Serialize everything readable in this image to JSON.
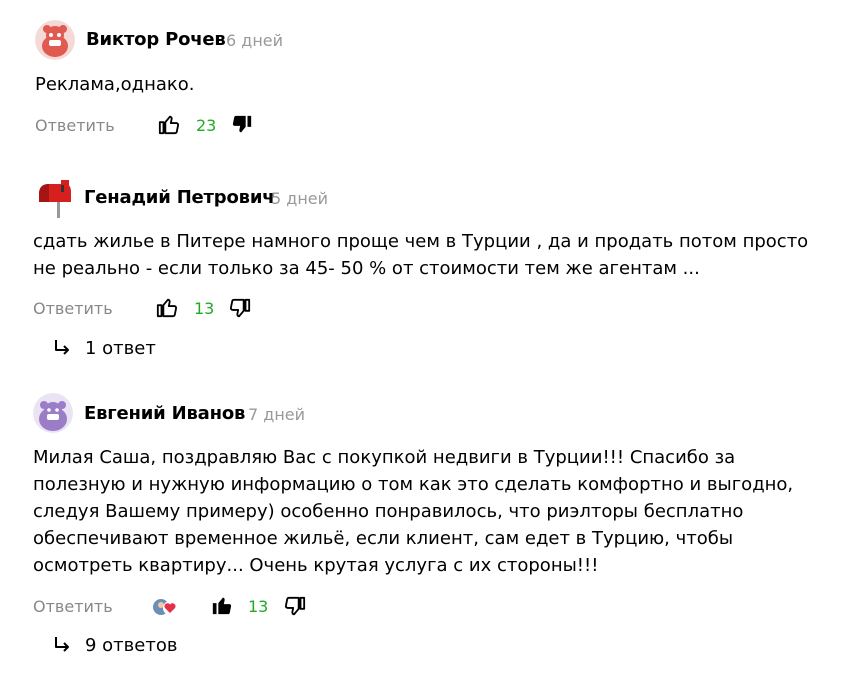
{
  "comments": [
    {
      "author": "Виктор Рочев",
      "date": "6 дней",
      "text": "Реклама,однако.",
      "reply_label": "Ответить",
      "likes": "23",
      "avatar_icon": "red-face-avatar"
    },
    {
      "author": "Генадий Петрович",
      "date": "5 дней",
      "text": "сдать жилье в Питере намного проще чем в Турции , да и продать потом просто\nне реально - если только за 45- 50 % от стоимости тем же агентам ...",
      "reply_label": "Ответить",
      "likes": "13",
      "answers": "1 ответ",
      "avatar_icon": "mailbox-avatar"
    },
    {
      "author": "Евгений Иванов",
      "date": "7 дней",
      "text": "Милая Саша, поздравляю Вас с покупкой недвиги в Турции!!! Спасибо за\nполезную и нужную информацию о том как это сделать комфортно и выгодно,\nследуя Вашему примеру) особенно понравилось, что риэлторы бесплатно\nобеспечивают временное жильё, если клиент, сам едет в Турцию, чтобы\nосмотреть квартиру... Очень крутая услуга с их стороны!!!",
      "reply_label": "Ответить",
      "likes": "13",
      "answers": "9 ответов",
      "avatar_icon": "purple-bear-avatar"
    }
  ],
  "colors": {
    "like_count": "#22aa22",
    "muted": "#999999"
  }
}
